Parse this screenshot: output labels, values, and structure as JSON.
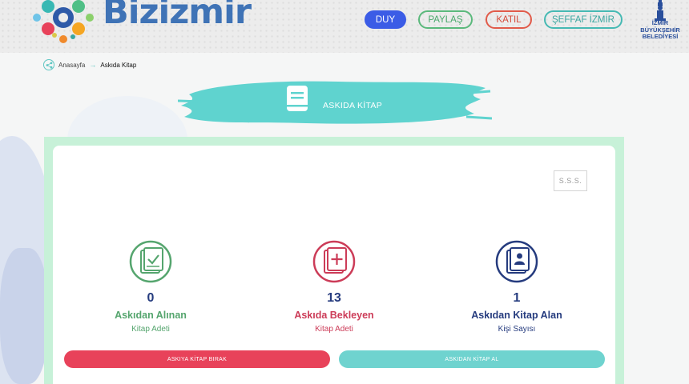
{
  "header": {
    "logo_text": "Bizizmir",
    "nav": {
      "duy": "DUY",
      "paylas": "PAYLAŞ",
      "katil": "KATIL",
      "seffaf": "ŞEFFAF İZMİR"
    },
    "ibb_logo": [
      "İZMİR",
      "BÜYÜKŞEHİR",
      "BELEDİYESİ"
    ]
  },
  "breadcrumb": {
    "home": "Anasayfa",
    "current": "Askıda Kitap"
  },
  "banner": {
    "title": "ASKIDA KİTAP",
    "icon": "book-icon"
  },
  "faq_button": "S.S.S.",
  "stats": [
    {
      "icon": "book-check-icon",
      "value": "0",
      "label": "Askıdan Alınan",
      "sub": "Kitap Adeti",
      "color": "#55a56e"
    },
    {
      "icon": "book-plus-icon",
      "value": "13",
      "label": "Askıda Bekleyen",
      "sub": "Kitap Adeti",
      "color": "#cc3c58"
    },
    {
      "icon": "book-person-icon",
      "value": "1",
      "label": "Askıdan Kitap Alan",
      "sub": "Kişi Sayısı",
      "color": "#253b7e"
    }
  ],
  "actions": {
    "leave": "ASKIYA KİTAP BIRAK",
    "take": "ASKIDAN KİTAP AL"
  },
  "colors": {
    "accent_teal": "#5fd3cf",
    "card_border": "#c7f1d8",
    "primary_blue": "#3b5ce6"
  }
}
